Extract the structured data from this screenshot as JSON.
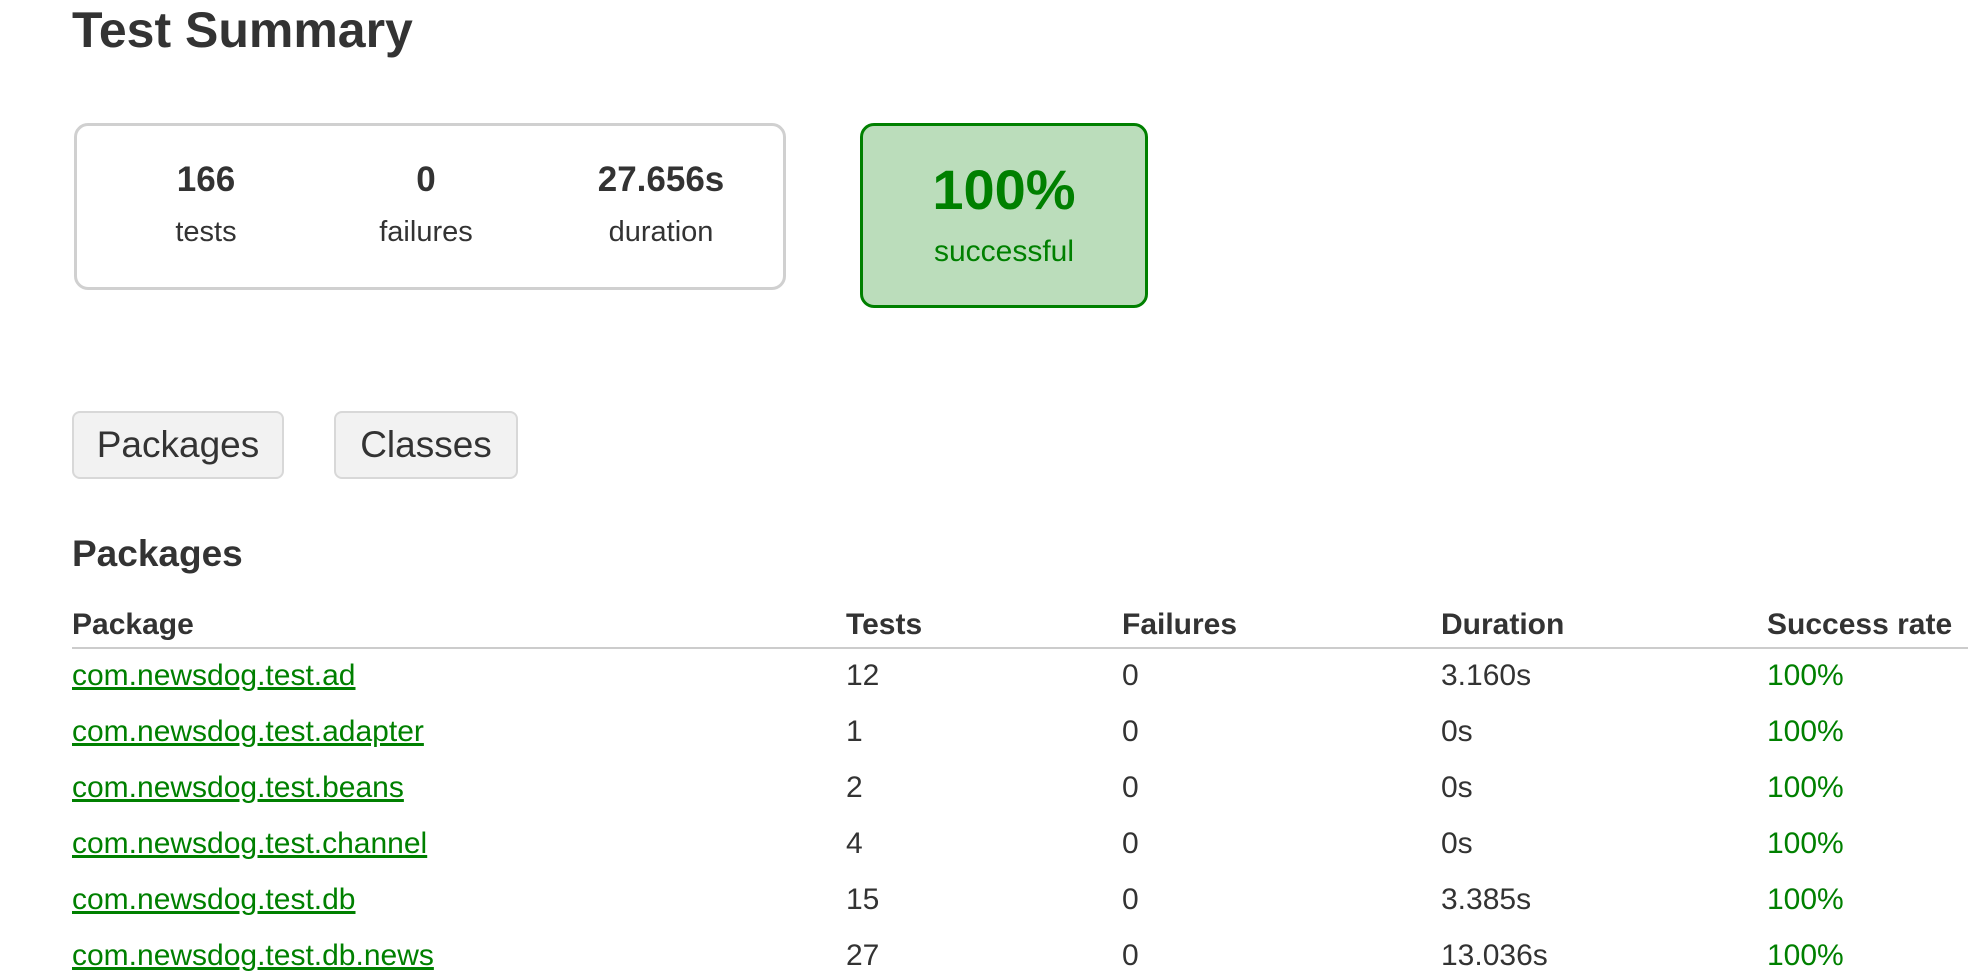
{
  "header": {
    "title": "Test Summary"
  },
  "summary": {
    "tests_value": "166",
    "tests_label": "tests",
    "failures_value": "0",
    "failures_label": "failures",
    "duration_value": "27.656s",
    "duration_label": "duration",
    "success_value": "100%",
    "success_label": "successful"
  },
  "tabs": [
    {
      "label": "Packages"
    },
    {
      "label": "Classes"
    }
  ],
  "packages": {
    "section_title": "Packages",
    "columns": [
      "Package",
      "Tests",
      "Failures",
      "Duration",
      "Success rate"
    ],
    "rows": [
      {
        "package": "com.newsdog.test.ad",
        "tests": "12",
        "failures": "0",
        "duration": "3.160s",
        "rate": "100%"
      },
      {
        "package": "com.newsdog.test.adapter",
        "tests": "1",
        "failures": "0",
        "duration": "0s",
        "rate": "100%"
      },
      {
        "package": "com.newsdog.test.beans",
        "tests": "2",
        "failures": "0",
        "duration": "0s",
        "rate": "100%"
      },
      {
        "package": "com.newsdog.test.channel",
        "tests": "4",
        "failures": "0",
        "duration": "0s",
        "rate": "100%"
      },
      {
        "package": "com.newsdog.test.db",
        "tests": "15",
        "failures": "0",
        "duration": "3.385s",
        "rate": "100%"
      },
      {
        "package": "com.newsdog.test.db.news",
        "tests": "27",
        "failures": "0",
        "duration": "13.036s",
        "rate": "100%"
      }
    ]
  },
  "colors": {
    "success_green": "#008000",
    "success_background": "#bbddbb",
    "text": "#333333",
    "border": "#d0d0d0"
  }
}
